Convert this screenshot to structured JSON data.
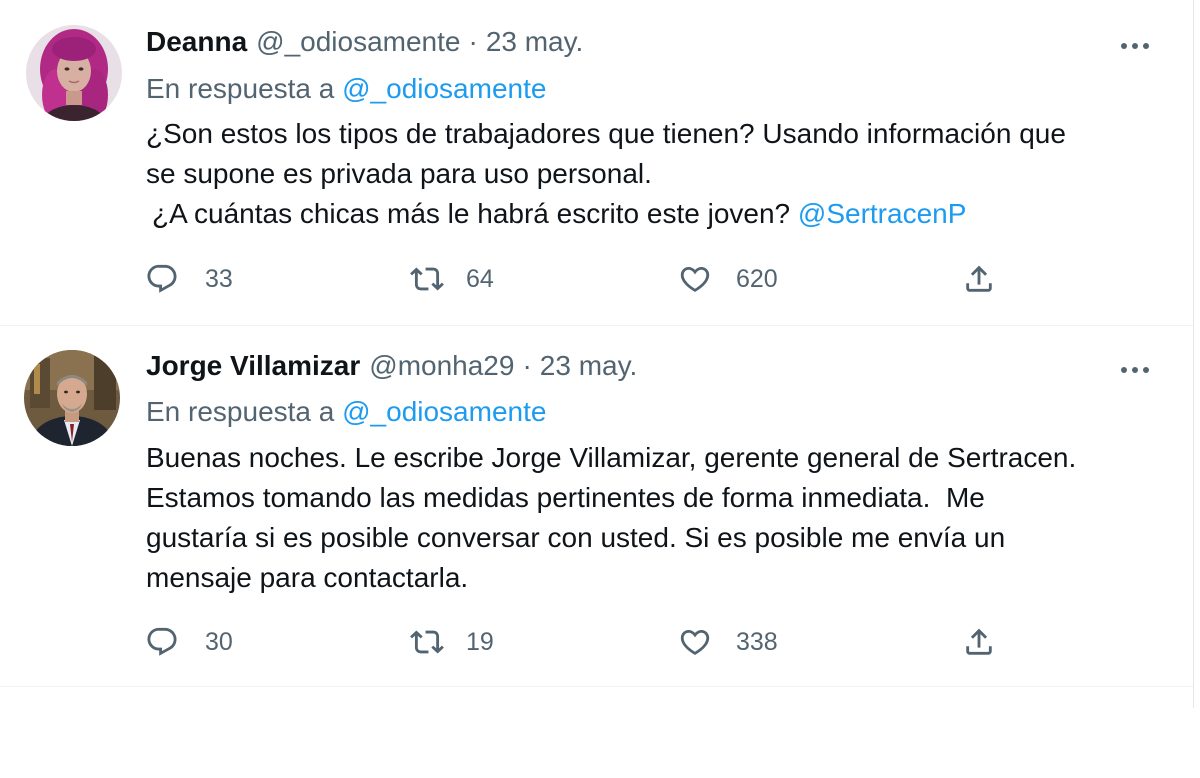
{
  "tweets": [
    {
      "author_name": "Deanna",
      "handle": "@_odiosamente",
      "separator": "·",
      "date": "23 may.",
      "reply_label": "En respuesta a",
      "reply_mention": "@_odiosamente",
      "text_lines": [
        "¿Son estos los tipos de trabajadores que tienen? Usando información que",
        "se supone es privada para uso personal.",
        "¿A cuántas chicas más le habrá escrito este joven?"
      ],
      "text_mention": "@SertracenP",
      "replies": "33",
      "retweets": "64",
      "likes": "620"
    },
    {
      "author_name": "Jorge Villamizar",
      "handle": "@monha29",
      "separator": "·",
      "date": "23 may.",
      "reply_label": "En respuesta a",
      "reply_mention": "@_odiosamente",
      "text_lines": [
        "Buenas noches. Le escribe Jorge Villamizar, gerente general de Sertracen.",
        "Estamos tomando las medidas pertinentes de forma inmediata.  Me",
        "gustaría si es posible conversar con usted. Si es posible me envía un",
        "mensaje para contactarla."
      ],
      "replies": "30",
      "retweets": "19",
      "likes": "338"
    }
  ],
  "icons": {
    "reply": "reply-icon",
    "retweet": "retweet-icon",
    "like": "heart-icon",
    "share": "share-icon",
    "more": "more-icon"
  },
  "colors": {
    "text": "#0f1419",
    "secondary": "#536471",
    "link": "#1d9bf0",
    "divider": "#eff3f4"
  }
}
